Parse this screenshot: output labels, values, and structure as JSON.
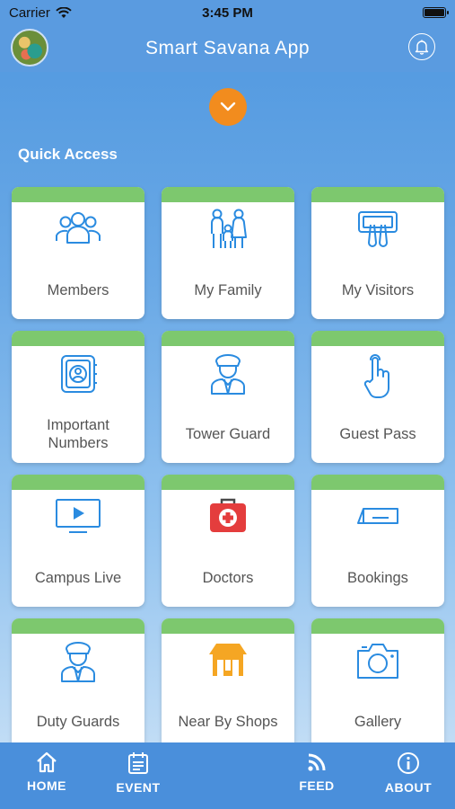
{
  "status_bar": {
    "carrier": "Carrier",
    "time": "3:45 PM"
  },
  "header": {
    "title": "Smart Savana App"
  },
  "quick_access": {
    "title": "Quick Access",
    "tiles": [
      {
        "label": "Members",
        "icon": "members-icon"
      },
      {
        "label": "My Family",
        "icon": "family-icon"
      },
      {
        "label": "My Visitors",
        "icon": "visitors-icon"
      },
      {
        "label": "Important Numbers",
        "icon": "contacts-book-icon"
      },
      {
        "label": "Tower  Guard",
        "icon": "guard-icon"
      },
      {
        "label": "Guest Pass",
        "icon": "tap-hand-icon"
      },
      {
        "label": "Campus Live",
        "icon": "tv-play-icon"
      },
      {
        "label": "Doctors",
        "icon": "first-aid-kit-icon"
      },
      {
        "label": "Bookings",
        "icon": "ticket-icon"
      },
      {
        "label": "Duty Guards",
        "icon": "guard-icon"
      },
      {
        "label": "Near By Shops",
        "icon": "shop-icon"
      },
      {
        "label": "Gallery",
        "icon": "camera-icon"
      }
    ]
  },
  "tab_bar": {
    "home": "HOME",
    "event": "EVENT",
    "feed": "FEED",
    "about": "ABOUT"
  },
  "colors": {
    "accent_orange": "#f28c1e",
    "tile_top_green": "#7dc86e",
    "icon_blue": "#2a8be0",
    "tab_bar_blue": "#4a8fdb"
  }
}
